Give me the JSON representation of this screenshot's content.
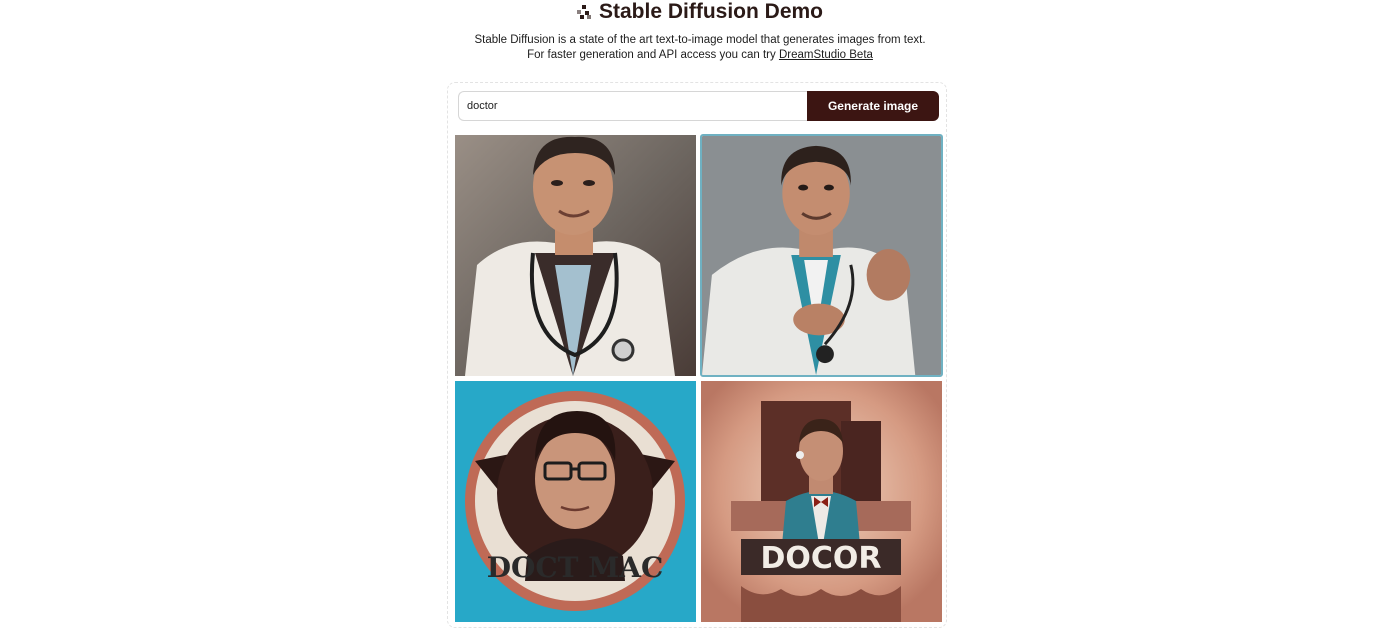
{
  "header": {
    "title": "Stable Diffusion Demo",
    "subtitle_line1": "Stable Diffusion is a state of the art text-to-image model that generates images from text.",
    "subtitle_line2_prefix": "For faster generation and API access you can try",
    "subtitle_link": "DreamStudio Beta"
  },
  "prompt": {
    "value": "doctor",
    "button_label": "Generate image"
  },
  "gallery": {
    "images": [
      {
        "name": "generated-image-1"
      },
      {
        "name": "generated-image-2"
      },
      {
        "name": "generated-image-3",
        "caption": "DOCT MAC"
      },
      {
        "name": "generated-image-4",
        "caption": "DOCOR"
      }
    ]
  },
  "colors": {
    "button": "#3c1512",
    "text": "#2b1a17",
    "selected_border": "#6fb1c2"
  }
}
